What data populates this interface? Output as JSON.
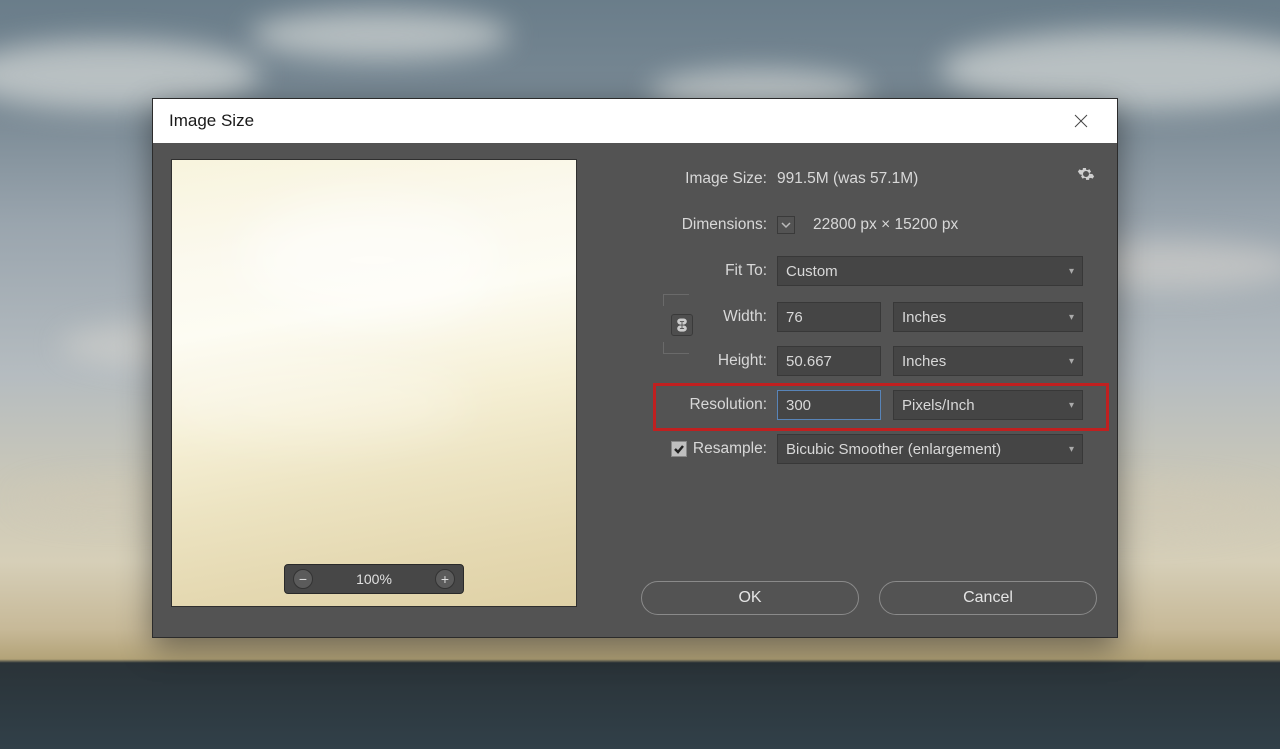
{
  "titlebar": {
    "title": "Image Size"
  },
  "info": {
    "image_size_label": "Image Size:",
    "image_size_value": "991.5M (was 57.1M)",
    "dimensions_label": "Dimensions:",
    "dimensions_value": "22800 px  ×  15200 px"
  },
  "fitto": {
    "label": "Fit To:",
    "value": "Custom"
  },
  "width": {
    "label": "Width:",
    "value": "76",
    "unit": "Inches"
  },
  "height": {
    "label": "Height:",
    "value": "50.667",
    "unit": "Inches"
  },
  "resolution": {
    "label": "Resolution:",
    "value": "300",
    "unit": "Pixels/Inch"
  },
  "resample": {
    "label": "Resample:",
    "method": "Bicubic Smoother (enlargement)"
  },
  "zoom": {
    "value": "100%"
  },
  "buttons": {
    "ok": "OK",
    "cancel": "Cancel"
  }
}
